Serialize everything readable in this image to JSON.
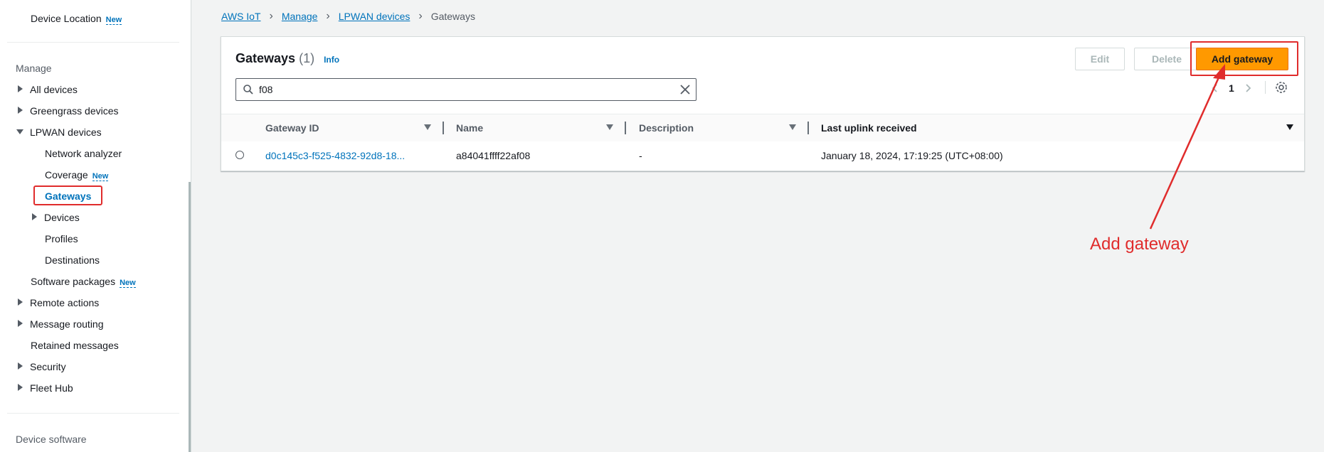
{
  "sidebar": {
    "top_item": {
      "label": "Device Location",
      "badge": "New"
    },
    "section_manage": "Manage",
    "items": [
      {
        "label": "All devices"
      },
      {
        "label": "Greengrass devices"
      },
      {
        "label": "LPWAN devices"
      },
      {
        "label": "Network analyzer"
      },
      {
        "label": "Coverage",
        "badge": "New"
      },
      {
        "label": "Gateways"
      },
      {
        "label": "Devices"
      },
      {
        "label": "Profiles"
      },
      {
        "label": "Destinations"
      },
      {
        "label": "Software packages",
        "badge": "New"
      },
      {
        "label": "Remote actions"
      },
      {
        "label": "Message routing"
      },
      {
        "label": "Retained messages"
      },
      {
        "label": "Security"
      },
      {
        "label": "Fleet Hub"
      }
    ],
    "section_device_software": "Device software"
  },
  "breadcrumb": {
    "items": [
      "AWS IoT",
      "Manage",
      "LPWAN devices"
    ],
    "current": "Gateways"
  },
  "panel": {
    "title": "Gateways",
    "count": "(1)",
    "info": "Info",
    "buttons": {
      "edit": "Edit",
      "delete": "Delete",
      "add": "Add gateway"
    },
    "search_value": "f08",
    "page": "1"
  },
  "table": {
    "columns": [
      "Gateway ID",
      "Name",
      "Description",
      "Last uplink received"
    ],
    "rows": [
      {
        "gateway_id": "d0c145c3-f525-4832-92d8-18...",
        "name": "a84041ffff22af08",
        "description": "-",
        "last_uplink": "January 18, 2024, 17:19:25 (UTC+08:00)"
      }
    ]
  },
  "annotation": {
    "text": "Add gateway",
    "color": "#e02c2c"
  },
  "colors": {
    "accent": "#0073bb",
    "primary_button": "#ff9900",
    "annotation": "#e02c2c"
  }
}
